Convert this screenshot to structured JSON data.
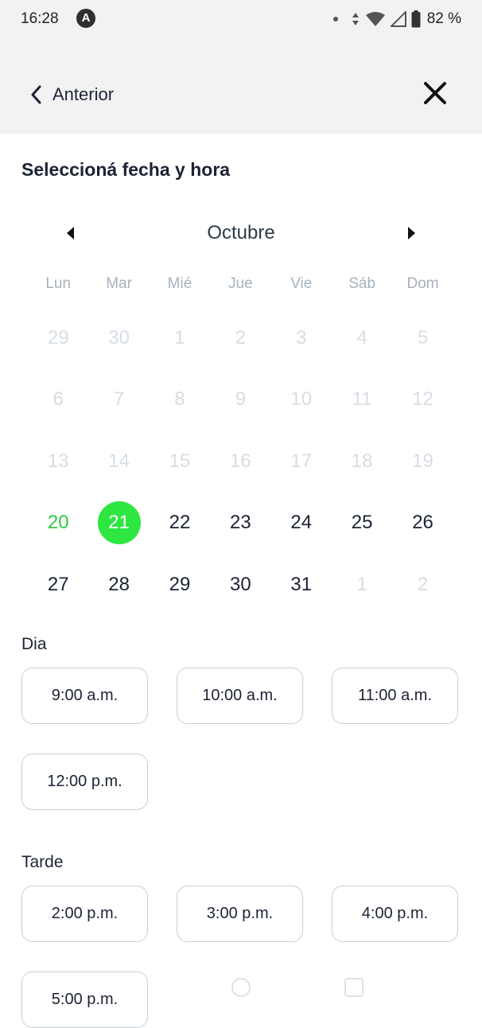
{
  "status_bar": {
    "time": "16:28",
    "app_icon": "A",
    "battery": "82 %"
  },
  "header": {
    "back_label": "Anterior",
    "back_icon": "chevron-left-icon",
    "close_icon": "close-icon"
  },
  "title": "Seleccioná fecha y hora",
  "calendar": {
    "month": "Octubre",
    "weekdays": [
      "Lun",
      "Mar",
      "Mié",
      "Jue",
      "Vie",
      "Sáb",
      "Dom"
    ],
    "weeks": [
      [
        "29",
        "30",
        "1",
        "2",
        "3",
        "4",
        "5"
      ],
      [
        "6",
        "7",
        "8",
        "9",
        "10",
        "11",
        "12"
      ],
      [
        "13",
        "14",
        "15",
        "16",
        "17",
        "18",
        "19"
      ],
      [
        "20",
        "21",
        "22",
        "23",
        "24",
        "25",
        "26"
      ],
      [
        "27",
        "28",
        "29",
        "30",
        "31",
        "1",
        "2"
      ]
    ],
    "today": "20",
    "selected": "21",
    "accent_color": "#2ee640"
  },
  "morning": {
    "label": "Dia",
    "slots": [
      "9:00 a.m.",
      "10:00 a.m.",
      "11:00 a.m.",
      "12:00 p.m."
    ]
  },
  "afternoon": {
    "label": "Tarde",
    "slots": [
      "2:00 p.m.",
      "3:00 p.m.",
      "4:00 p.m.",
      "5:00 p.m."
    ]
  }
}
